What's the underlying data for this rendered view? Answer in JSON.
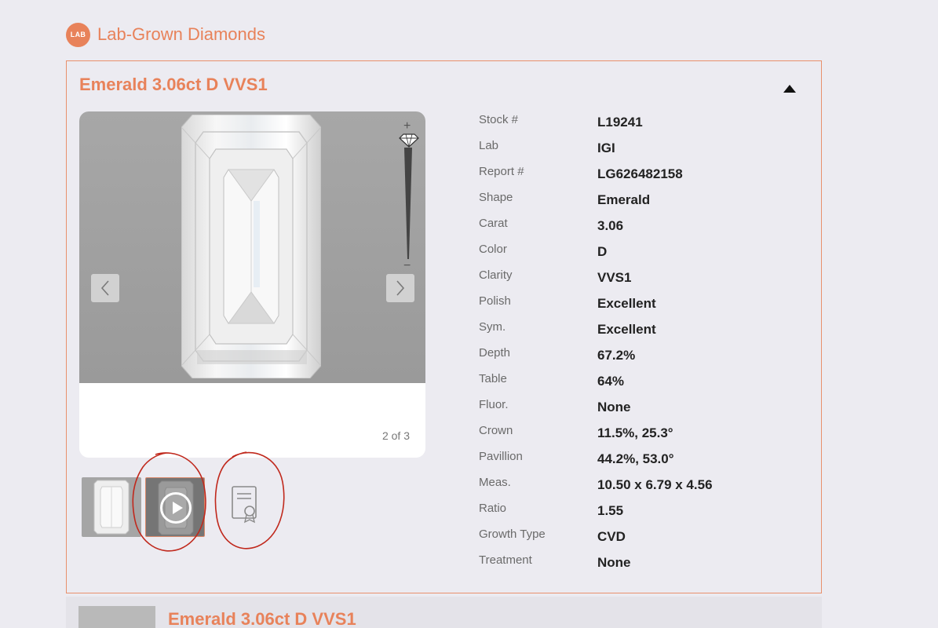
{
  "brand": {
    "logo_text": "LAB",
    "title": "Lab-Grown Diamonds"
  },
  "colors": {
    "accent": "#e8825a",
    "annotation": "#c0281c"
  },
  "card": {
    "title": "Emerald 3.06ct D VVS1",
    "toggle_icon": "triangle-up-icon",
    "viewer": {
      "zoom_plus": "+",
      "zoom_minus": "−",
      "counter": "2 of 3"
    },
    "thumbnails": [
      {
        "name": "thumb-image",
        "icon": "diamond-image"
      },
      {
        "name": "thumb-video",
        "icon": "play-icon",
        "selected": true
      },
      {
        "name": "thumb-certificate",
        "icon": "certificate-icon"
      }
    ],
    "specs": [
      {
        "label": "Stock #",
        "value": "L19241"
      },
      {
        "label": "Lab",
        "value": "IGI"
      },
      {
        "label": "Report #",
        "value": "LG626482158"
      },
      {
        "label": "Shape",
        "value": "Emerald"
      },
      {
        "label": "Carat",
        "value": "3.06"
      },
      {
        "label": "Color",
        "value": "D"
      },
      {
        "label": "Clarity",
        "value": "VVS1"
      },
      {
        "label": "Polish",
        "value": "Excellent"
      },
      {
        "label": "Sym.",
        "value": "Excellent"
      },
      {
        "label": "Depth",
        "value": "67.2%"
      },
      {
        "label": "Table",
        "value": "64%"
      },
      {
        "label": "Fluor.",
        "value": "None"
      },
      {
        "label": "Crown",
        "value": "11.5%, 25.3°"
      },
      {
        "label": "Pavillion",
        "value": "44.2%, 53.0°"
      },
      {
        "label": "Meas.",
        "value": "10.50 x 6.79 x 4.56"
      },
      {
        "label": "Ratio",
        "value": "1.55"
      },
      {
        "label": "Growth Type",
        "value": "CVD"
      },
      {
        "label": "Treatment",
        "value": "None"
      }
    ]
  },
  "next_card": {
    "title": "Emerald 3.06ct D VVS1"
  }
}
